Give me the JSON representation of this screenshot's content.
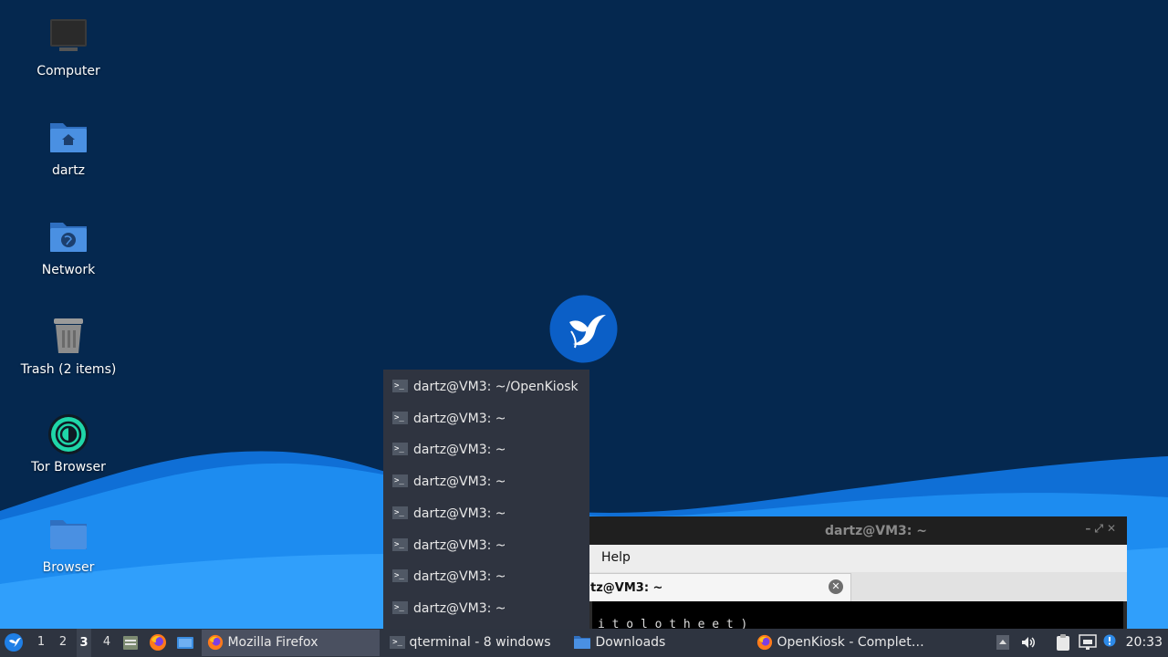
{
  "desktop": {
    "icons": [
      {
        "label": "Computer",
        "icon": "computer-icon"
      },
      {
        "label": "dartz",
        "icon": "home-folder-icon"
      },
      {
        "label": "Network",
        "icon": "network-folder-icon"
      },
      {
        "label": "Trash (2 items)",
        "icon": "trash-icon"
      },
      {
        "label": "Tor Browser",
        "icon": "tor-browser-icon"
      },
      {
        "label": "Browser",
        "icon": "folder-icon"
      }
    ]
  },
  "terminal_window": {
    "title": "dartz@VM3: ~",
    "menu": [
      "Help"
    ],
    "tab_label": "tz@VM3: ~",
    "body_text": "          i t                        o     l      o     t h     e     e  t  )    "
  },
  "window_list_popup": {
    "items": [
      "dartz@VM3: ~/OpenKiosk",
      "dartz@VM3: ~",
      "dartz@VM3: ~",
      "dartz@VM3: ~",
      "dartz@VM3: ~",
      "dartz@VM3: ~",
      "dartz@VM3: ~",
      "dartz@VM3: ~"
    ]
  },
  "taskbar": {
    "workspaces": [
      "1",
      "2",
      "3",
      "4"
    ],
    "active_workspace": "3",
    "tasks": [
      {
        "label": "Mozilla Firefox",
        "icon": "firefox-icon"
      },
      {
        "label": "qterminal - 8 windows",
        "icon": "terminal-icon"
      },
      {
        "label": "Downloads",
        "icon": "folder-icon"
      },
      {
        "label": "OpenKiosk - Complet…",
        "icon": "firefox-icon"
      }
    ],
    "clock": "20:33"
  },
  "colors": {
    "desktop_bg": "#05284f",
    "taskbar_bg": "#2e3440",
    "popup_bg": "#2f3440",
    "accent_blue": "#1f7fe6"
  }
}
